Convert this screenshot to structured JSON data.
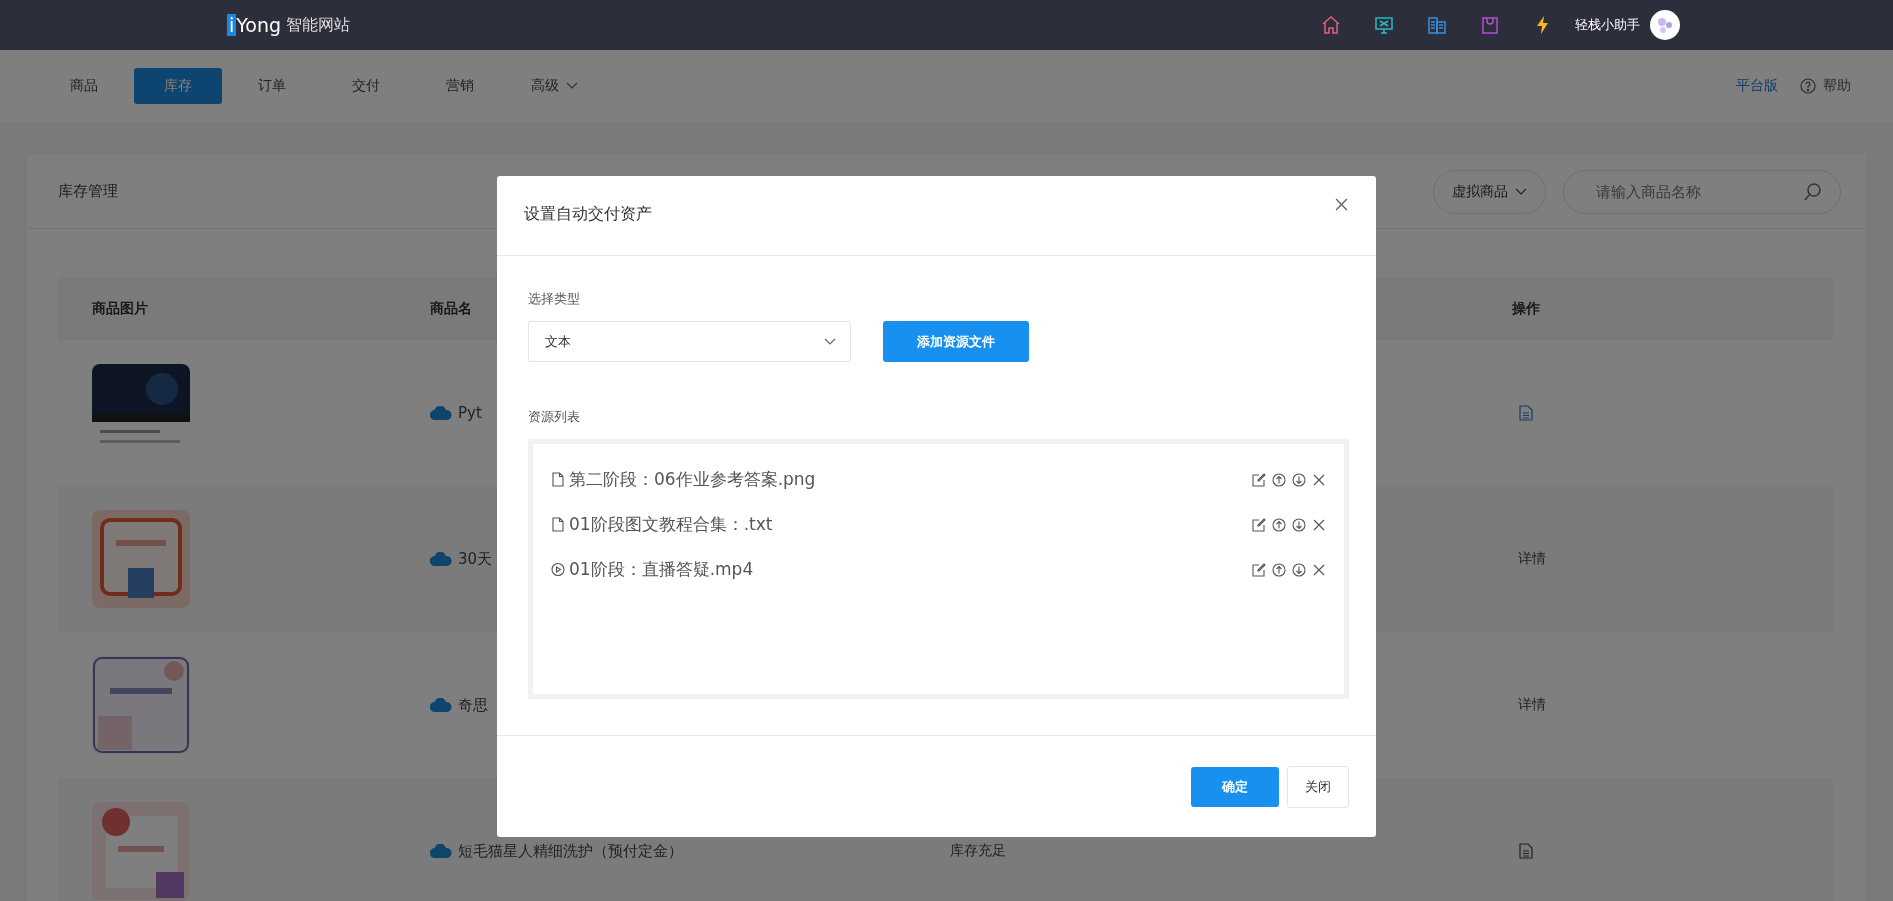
{
  "header": {
    "logo_mark": "i",
    "logo_text": "Yong",
    "site_name": "智能网站",
    "user_name": "轻栈小助手"
  },
  "nav": {
    "tabs": [
      {
        "label": "商品",
        "selected": false,
        "kind": "plain"
      },
      {
        "label": "库存",
        "selected": true,
        "kind": "plain"
      },
      {
        "label": "订单",
        "selected": false,
        "kind": "plain"
      },
      {
        "label": "交付",
        "selected": false,
        "kind": "plain"
      },
      {
        "label": "营销",
        "selected": false,
        "kind": "plain"
      },
      {
        "label": "高级",
        "selected": false,
        "kind": "dropdown"
      }
    ],
    "platform_link": "平台版",
    "help_link": "帮助"
  },
  "page": {
    "title": "库存管理",
    "filter": "虚拟商品",
    "search": {
      "placeholder": "请输入商品名称"
    }
  },
  "table": {
    "columns": [
      "商品图片",
      "商品名",
      "操作"
    ],
    "rows": [
      {
        "name": "Pyt",
        "action": {
          "kind": "doc",
          "active": true
        }
      },
      {
        "name": "30天",
        "action": {
          "kind": "text",
          "label": "详情"
        }
      },
      {
        "name": "奇思",
        "action": {
          "kind": "text",
          "label": "详情"
        }
      },
      {
        "name": "短毛猫星人精细洗护（预付定金）",
        "stock": "库存充足",
        "action": {
          "kind": "doc",
          "active": false
        }
      }
    ]
  },
  "dialog": {
    "title": "设置自动交付资产",
    "type_label": "选择类型",
    "type_value": "文本",
    "add_button": "添加资源文件",
    "list_label": "资源列表",
    "resources": [
      {
        "kind": "file",
        "name": "第二阶段：06作业参考答案.png"
      },
      {
        "kind": "file",
        "name": "01阶段图文教程合集：.txt"
      },
      {
        "kind": "video",
        "name": "01阶段：直播答疑.mp4"
      }
    ],
    "confirm_button": "确定",
    "close_button": "关闭"
  }
}
